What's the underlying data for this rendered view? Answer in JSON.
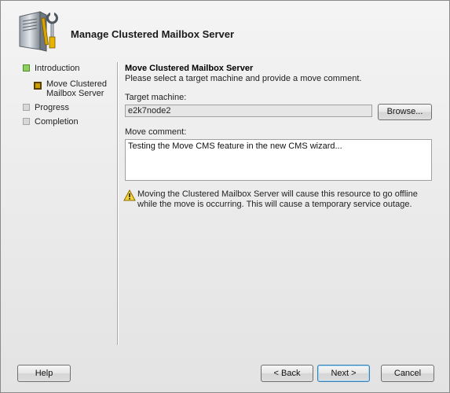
{
  "window": {
    "title": "Manage Clustered Mailbox Server"
  },
  "nav": {
    "items": [
      {
        "label": "Introduction",
        "status": "complete"
      },
      {
        "label": "Move Clustered Mailbox Server",
        "status": "current"
      },
      {
        "label": "Progress",
        "status": "pending"
      },
      {
        "label": "Completion",
        "status": "pending"
      }
    ]
  },
  "content": {
    "section_title": "Move Clustered Mailbox Server",
    "description": "Please select a target machine and provide a move comment.",
    "target_label": "Target machine:",
    "target_value": "e2k7node2",
    "browse_label": "Browse...",
    "comment_label": "Move comment:",
    "comment_value": "Testing the Move CMS feature in the new CMS wizard...",
    "warning_text": "Moving the Clustered Mailbox Server will cause this resource to go offline while the move is occurring. This will cause a temporary service outage."
  },
  "footer": {
    "help_label": "Help",
    "back_label": "< Back",
    "next_label": "Next >",
    "cancel_label": "Cancel"
  },
  "icons": {
    "wizard": "server-with-tools-icon",
    "warning": "warning-icon"
  },
  "colors": {
    "nav_complete": "#8fcf60",
    "nav_current": "#c9a000",
    "nav_pending": "#d8d8d8",
    "default_button_border": "#3c7fb1"
  }
}
